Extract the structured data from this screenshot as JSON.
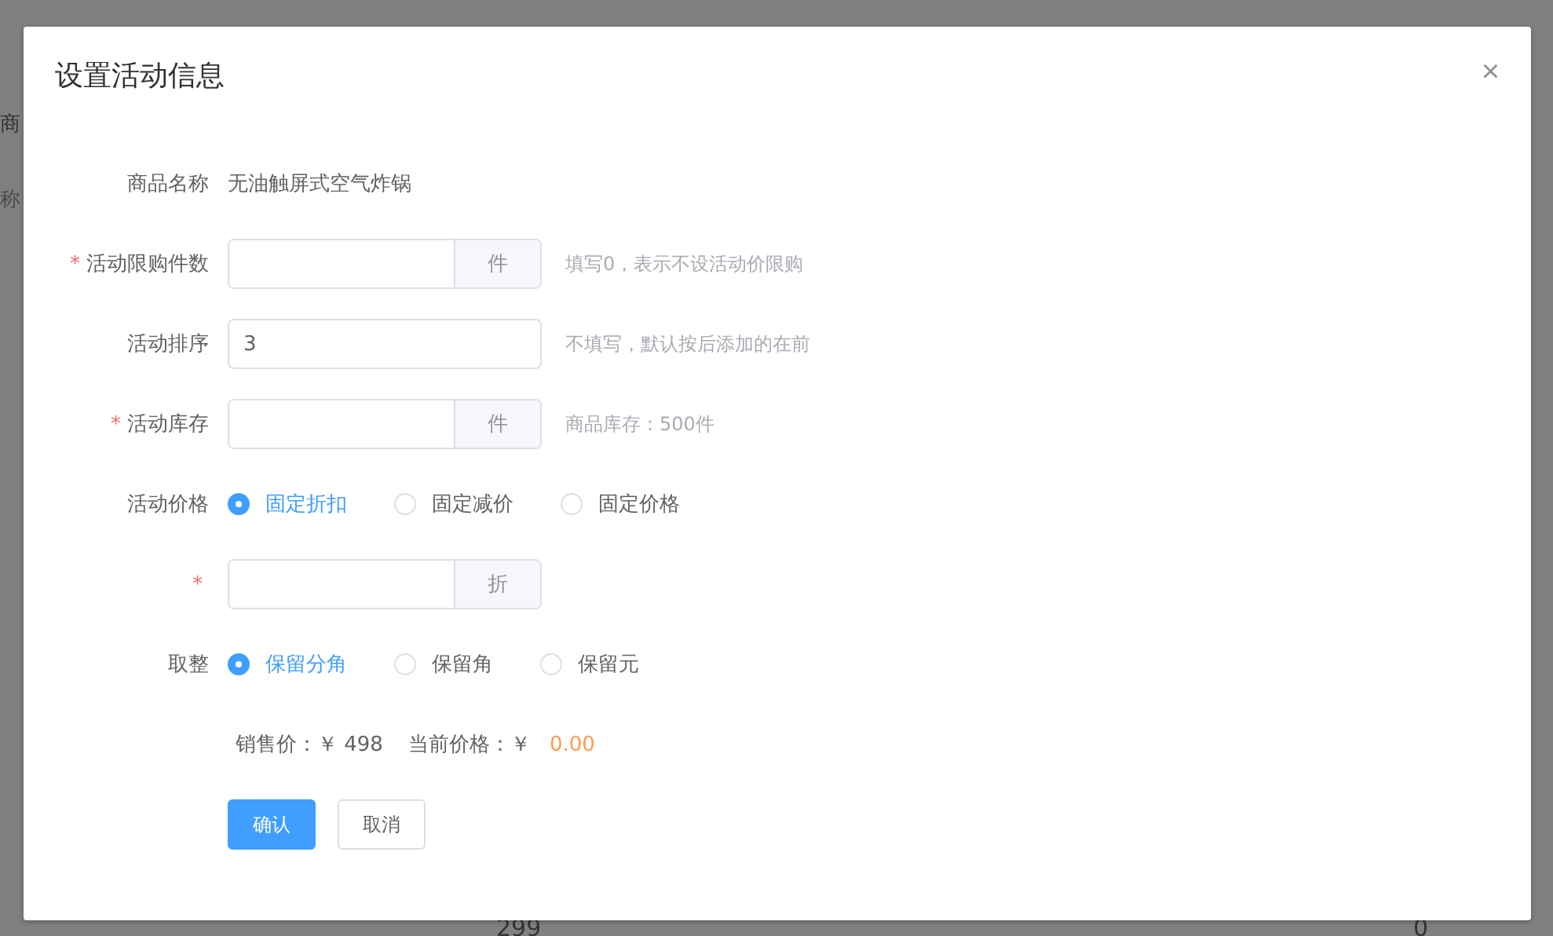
{
  "background_page": {
    "texts": [
      {
        "kind": "header",
        "text": "商"
      },
      {
        "kind": "placeholder",
        "text": "称"
      },
      {
        "kind": "footer_left",
        "text": "299"
      },
      {
        "kind": "footer_right",
        "text": "0"
      }
    ]
  },
  "dialog": {
    "title": "设置活动信息",
    "close": "×"
  },
  "fields": [
    {
      "kind": "text",
      "label": "商品名称",
      "value": "无油触屏式空气炸锅"
    },
    {
      "kind": "append",
      "required_mark": "*",
      "label": "活动限购件数",
      "append": "件",
      "hint": "填写0，表示不设活动价限购"
    },
    {
      "kind": "input",
      "label": "活动排序",
      "value": "3",
      "hint": "不填写，默认按后添加的在前"
    },
    {
      "kind": "append",
      "required_mark": "*",
      "label": "活动库存",
      "append": "件",
      "hint": "商品库存：500件"
    },
    {
      "kind": "radio",
      "label": "活动价格",
      "options": [
        {
          "label": "固定折扣",
          "selected": true
        },
        {
          "label": "固定减价",
          "selected": false
        },
        {
          "label": "固定价格",
          "selected": false
        }
      ]
    },
    {
      "kind": "append",
      "required_mark": "*",
      "append": "折"
    },
    {
      "kind": "radio",
      "label": "取整",
      "options": [
        {
          "label": "保留分角",
          "selected": true
        },
        {
          "label": "保留角",
          "selected": false
        },
        {
          "label": "保留元",
          "selected": false
        }
      ]
    },
    {
      "kind": "summary",
      "sale_label": "销售价：￥ 498",
      "current_label": "当前价格：￥",
      "current_value": "0.00"
    }
  ],
  "buttons": [
    {
      "label": "确认",
      "kind": "primary"
    },
    {
      "label": "取消",
      "kind": "default"
    }
  ]
}
